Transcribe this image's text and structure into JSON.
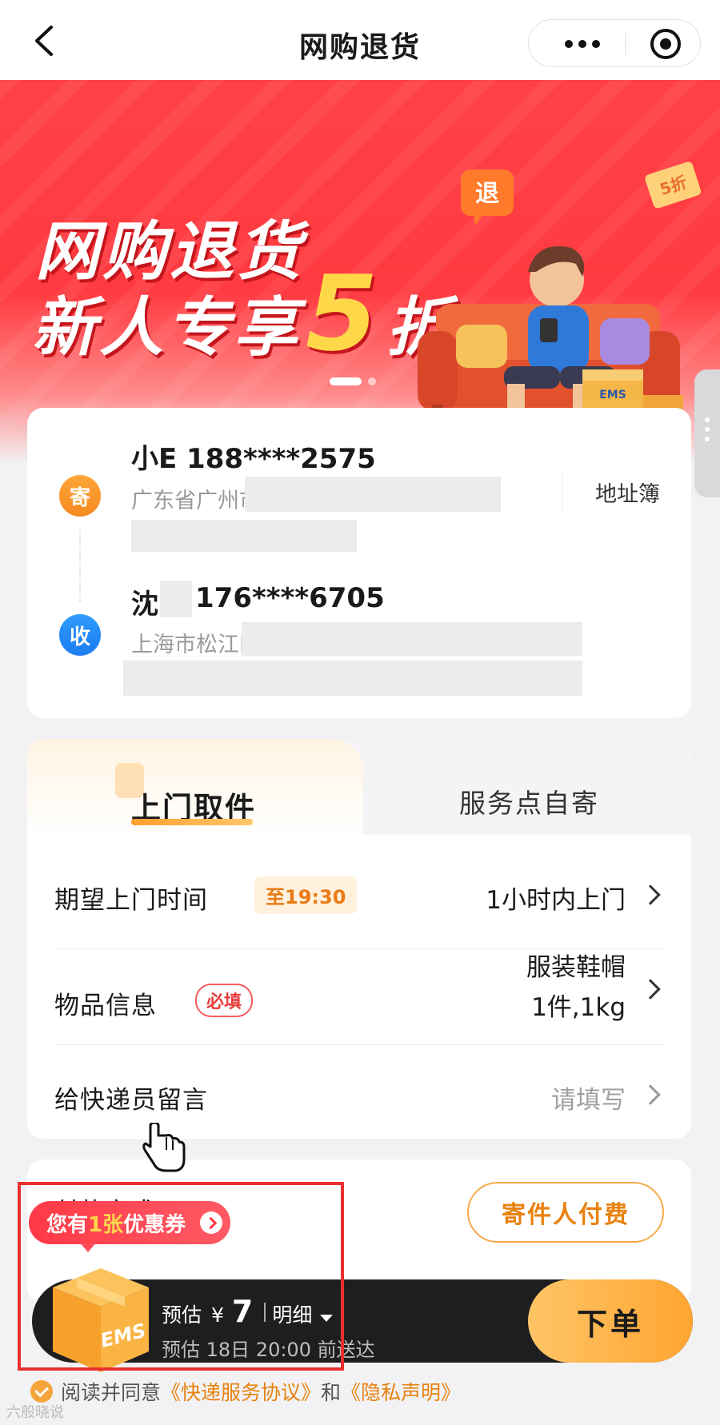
{
  "header": {
    "title": "网购退货"
  },
  "banner": {
    "line1": "网购退货",
    "line2_prefix": "新人专享",
    "line2_number": "5",
    "line2_suffix": "折",
    "speech_bubble": "退",
    "tag": "5折",
    "ems_label": "EMS",
    "slide_index": 1,
    "slide_count": 2
  },
  "sender": {
    "badge": "寄",
    "name_phone": "小E  188****2575",
    "address": "广东省广州市",
    "address_book": "地址簿"
  },
  "receiver": {
    "badge": "收",
    "name": "沈",
    "phone": "176****6705",
    "address": "上海市松江区"
  },
  "service": {
    "tabs": [
      {
        "label": "上门取件",
        "active": true
      },
      {
        "label": "服务点自寄",
        "active": false
      }
    ],
    "rows": {
      "pickup_time": {
        "label": "期望上门时间",
        "chip": "至19:30",
        "value": "1小时内上门"
      },
      "item_info": {
        "label": "物品信息",
        "chip": "必填",
        "value_line1": "服装鞋帽",
        "value_line2": "1件,1kg"
      },
      "courier_note": {
        "label": "给快递员留言",
        "placeholder": "请填写"
      }
    }
  },
  "payment": {
    "title": "付款方式",
    "option": "寄件人付费"
  },
  "coupon": {
    "prefix": "您有",
    "count": "1张",
    "suffix": "优惠券"
  },
  "bottom_bar": {
    "estimate_label": "预估",
    "currency": "¥",
    "amount": "7",
    "details_label": "明细",
    "arrival_text": "预估 18日 20:00 前送达",
    "order_button": "下单",
    "box_label": "EMS"
  },
  "agreement": {
    "prefix": "阅读并同意",
    "service_link": "《快递服务协议》",
    "and": "和",
    "privacy_link": "《隐私声明》"
  },
  "watermark": "六般晓说",
  "colors": {
    "brand_red": "#ff3a40",
    "accent_orange": "#f5a53a",
    "dark_bar": "#1e1e20",
    "highlight_red": "#e8302f"
  }
}
